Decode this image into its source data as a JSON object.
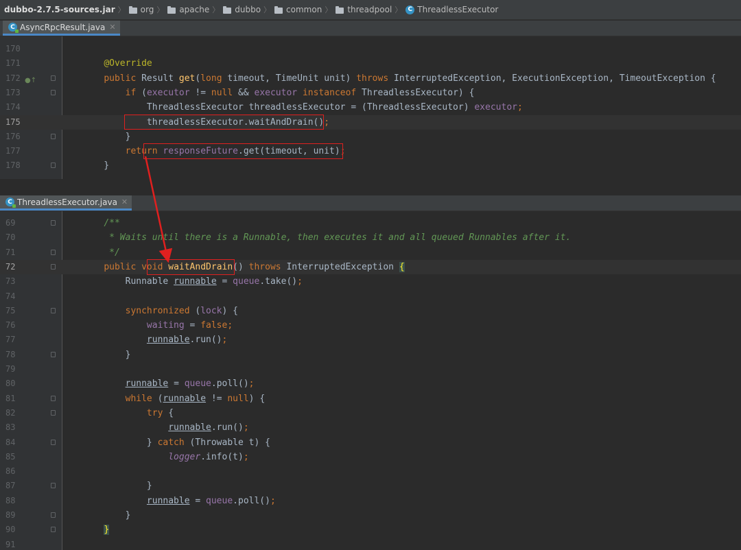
{
  "breadcrumb": [
    "dubbo-2.7.5-sources.jar",
    "org",
    "apache",
    "dubbo",
    "common",
    "threadpool",
    "ThreadlessExecutor"
  ],
  "pane1": {
    "tab": "AsyncRpcResult.java",
    "lines": [
      {
        "n": "170",
        "t": []
      },
      {
        "n": "171",
        "t": [
          [
            "    ",
            "id"
          ],
          [
            "@Override",
            "ann"
          ]
        ]
      },
      {
        "n": "172",
        "ovr": true,
        "fold": true,
        "t": [
          [
            "    ",
            "id"
          ],
          [
            "public ",
            "kw"
          ],
          [
            "Result ",
            "id"
          ],
          [
            "get",
            "mth"
          ],
          [
            "(",
            "id"
          ],
          [
            "long ",
            "kw"
          ],
          [
            "timeout, TimeUnit unit) ",
            "id"
          ],
          [
            "throws ",
            "kw"
          ],
          [
            "InterruptedException, ExecutionException, TimeoutException {",
            "id"
          ]
        ]
      },
      {
        "n": "173",
        "fold": true,
        "t": [
          [
            "        ",
            "id"
          ],
          [
            "if ",
            "kw"
          ],
          [
            "(",
            "id"
          ],
          [
            "executor ",
            "fld"
          ],
          [
            "!= ",
            "id"
          ],
          [
            "null ",
            "kw"
          ],
          [
            "&& ",
            "id"
          ],
          [
            "executor ",
            "fld"
          ],
          [
            "instanceof ",
            "kw"
          ],
          [
            "ThreadlessExecutor) {",
            "id"
          ]
        ]
      },
      {
        "n": "174",
        "t": [
          [
            "            ",
            "id"
          ],
          [
            "ThreadlessExecutor threadlessExecutor = (ThreadlessExecutor) ",
            "id"
          ],
          [
            "executor",
            "fld"
          ],
          [
            ";",
            "kw"
          ]
        ]
      },
      {
        "n": "175",
        "cur": true,
        "t": [
          [
            "            ",
            "id"
          ],
          [
            "threadlessExecutor.waitAndDrain()",
            "id"
          ],
          [
            ";",
            "kw"
          ]
        ]
      },
      {
        "n": "176",
        "fold": true,
        "t": [
          [
            "        }",
            "id"
          ]
        ]
      },
      {
        "n": "177",
        "t": [
          [
            "        ",
            "id"
          ],
          [
            "return ",
            "kw"
          ],
          [
            "responseFuture",
            "fld"
          ],
          [
            ".get(timeout, unit)",
            "id"
          ],
          [
            ";",
            "kw"
          ]
        ]
      },
      {
        "n": "178",
        "fold": true,
        "t": [
          [
            "    }",
            "id"
          ]
        ]
      }
    ]
  },
  "pane2": {
    "tab": "ThreadlessExecutor.java",
    "lines": [
      {
        "n": "69",
        "fold": true,
        "t": [
          [
            "    ",
            "id"
          ],
          [
            "/**",
            "cmt"
          ]
        ]
      },
      {
        "n": "70",
        "t": [
          [
            "     ",
            "id"
          ],
          [
            "* Waits until there is a Runnable, then executes it and all queued Runnables after it.",
            "cmt"
          ]
        ]
      },
      {
        "n": "71",
        "fold": true,
        "t": [
          [
            "     ",
            "id"
          ],
          [
            "*/",
            "cmt"
          ]
        ]
      },
      {
        "n": "72",
        "cur": true,
        "fold": true,
        "t": [
          [
            "    ",
            "id"
          ],
          [
            "public ",
            "kw"
          ],
          [
            "void ",
            "kw"
          ],
          [
            "waitAndDrain",
            "mth"
          ],
          [
            "() ",
            "id"
          ],
          [
            "throws ",
            "kw"
          ],
          [
            "InterruptedException ",
            "id"
          ],
          [
            "{",
            "brc"
          ]
        ]
      },
      {
        "n": "73",
        "t": [
          [
            "        Runnable ",
            "id"
          ],
          [
            "runnable",
            "var"
          ],
          [
            " = ",
            "id"
          ],
          [
            "queue",
            "fld"
          ],
          [
            ".take()",
            "id"
          ],
          [
            ";",
            "kw"
          ]
        ]
      },
      {
        "n": "74",
        "t": []
      },
      {
        "n": "75",
        "fold": true,
        "t": [
          [
            "        ",
            "id"
          ],
          [
            "synchronized ",
            "kw"
          ],
          [
            "(",
            "id"
          ],
          [
            "lock",
            "fld"
          ],
          [
            ") {",
            "id"
          ]
        ]
      },
      {
        "n": "76",
        "t": [
          [
            "            ",
            "id"
          ],
          [
            "waiting ",
            "fld"
          ],
          [
            "= ",
            "id"
          ],
          [
            "false",
            "kw"
          ],
          [
            ";",
            "kw"
          ]
        ]
      },
      {
        "n": "77",
        "t": [
          [
            "            ",
            "id"
          ],
          [
            "runnable",
            "var"
          ],
          [
            ".run()",
            "id"
          ],
          [
            ";",
            "kw"
          ]
        ]
      },
      {
        "n": "78",
        "fold": true,
        "t": [
          [
            "        }",
            "id"
          ]
        ]
      },
      {
        "n": "79",
        "t": []
      },
      {
        "n": "80",
        "t": [
          [
            "        ",
            "id"
          ],
          [
            "runnable",
            "var"
          ],
          [
            " = ",
            "id"
          ],
          [
            "queue",
            "fld"
          ],
          [
            ".poll()",
            "id"
          ],
          [
            ";",
            "kw"
          ]
        ]
      },
      {
        "n": "81",
        "fold": true,
        "t": [
          [
            "        ",
            "id"
          ],
          [
            "while ",
            "kw"
          ],
          [
            "(",
            "id"
          ],
          [
            "runnable",
            "var"
          ],
          [
            " != ",
            "id"
          ],
          [
            "null",
            "kw"
          ],
          [
            ") {",
            "id"
          ]
        ]
      },
      {
        "n": "82",
        "fold": true,
        "t": [
          [
            "            ",
            "id"
          ],
          [
            "try ",
            "kw"
          ],
          [
            "{",
            "id"
          ]
        ]
      },
      {
        "n": "83",
        "t": [
          [
            "                ",
            "id"
          ],
          [
            "runnable",
            "var"
          ],
          [
            ".run()",
            "id"
          ],
          [
            ";",
            "kw"
          ]
        ]
      },
      {
        "n": "84",
        "fold": true,
        "t": [
          [
            "            } ",
            "id"
          ],
          [
            "catch ",
            "kw"
          ],
          [
            "(Throwable t) {",
            "id"
          ]
        ]
      },
      {
        "n": "85",
        "t": [
          [
            "                ",
            "id"
          ],
          [
            "logger",
            "static"
          ],
          [
            ".info(t)",
            "id"
          ],
          [
            ";",
            "kw"
          ]
        ]
      },
      {
        "n": "86",
        "t": []
      },
      {
        "n": "87",
        "fold": true,
        "t": [
          [
            "            }",
            "id"
          ]
        ]
      },
      {
        "n": "88",
        "t": [
          [
            "            ",
            "id"
          ],
          [
            "runnable",
            "var"
          ],
          [
            " = ",
            "id"
          ],
          [
            "queue",
            "fld"
          ],
          [
            ".poll()",
            "id"
          ],
          [
            ";",
            "kw"
          ]
        ]
      },
      {
        "n": "89",
        "fold": true,
        "t": [
          [
            "        }",
            "id"
          ]
        ]
      },
      {
        "n": "90",
        "fold": true,
        "t": [
          [
            "    ",
            "id"
          ],
          [
            "}",
            "brc"
          ]
        ]
      },
      {
        "n": "91",
        "t": []
      }
    ]
  },
  "colors": {
    "highlight_box": "#e0201f",
    "arrow": "#e0201f",
    "keyword": "#cc7832",
    "field": "#9876aa",
    "method": "#ffc66d",
    "comment": "#629755",
    "annotation": "#bbb529"
  }
}
